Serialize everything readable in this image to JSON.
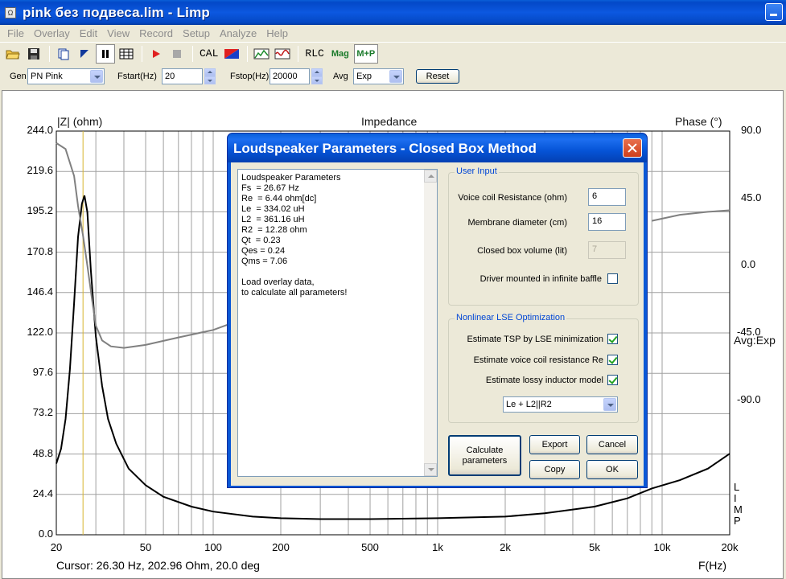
{
  "window": {
    "title": "pink без подвеса.lim - Limp",
    "icon": "app-icon"
  },
  "menu": [
    "File",
    "Overlay",
    "Edit",
    "View",
    "Record",
    "Setup",
    "Analyze",
    "Help"
  ],
  "toolbar": {
    "cal": "CAL",
    "rlc": "RLC",
    "mag": "Mag",
    "mp": "M+P"
  },
  "genbar": {
    "gen_label": "Gen",
    "gen_value": "PN Pink",
    "fstart_label": "Fstart(Hz)",
    "fstart_value": "20",
    "fstop_label": "Fstop(Hz)",
    "fstop_value": "20000",
    "avg_label": "Avg",
    "avg_value": "Exp",
    "reset": "Reset"
  },
  "chart_data": {
    "type": "line",
    "title": "Impedance",
    "ylabel": "|Z| (ohm)",
    "y2label": "Phase (°)",
    "xlabel": "F(Hz)",
    "xscale": "log",
    "xlim": [
      20,
      20000
    ],
    "ylim": [
      0,
      244
    ],
    "y2lim": [
      -180,
      90
    ],
    "yticks": [
      "244.0",
      "219.6",
      "195.2",
      "170.8",
      "146.4",
      "122.0",
      "97.6",
      "73.2",
      "48.8",
      "24.4",
      "0.0"
    ],
    "phase_ticks": [
      "90.0",
      "45.0",
      "0.0",
      "-45.0",
      "-90.0"
    ],
    "xticks": [
      {
        "v": 20,
        "label": "20"
      },
      {
        "v": 50,
        "label": "50"
      },
      {
        "v": 100,
        "label": "100"
      },
      {
        "v": 200,
        "label": "200"
      },
      {
        "v": 500,
        "label": "500"
      },
      {
        "v": 1000,
        "label": "1k"
      },
      {
        "v": 2000,
        "label": "2k"
      },
      {
        "v": 5000,
        "label": "5k"
      },
      {
        "v": 10000,
        "label": "10k"
      },
      {
        "v": 20000,
        "label": "20k"
      }
    ],
    "cursor_hz": 26.3,
    "series": [
      {
        "name": "|Z|",
        "color": "#000000",
        "points": [
          [
            20,
            43
          ],
          [
            21,
            52
          ],
          [
            22,
            70
          ],
          [
            23,
            100
          ],
          [
            24,
            140
          ],
          [
            25,
            180
          ],
          [
            26,
            200
          ],
          [
            26.7,
            205
          ],
          [
            27.5,
            195
          ],
          [
            28.5,
            160
          ],
          [
            30,
            120
          ],
          [
            32,
            90
          ],
          [
            34,
            70
          ],
          [
            37,
            55
          ],
          [
            42,
            40
          ],
          [
            50,
            30
          ],
          [
            60,
            23
          ],
          [
            80,
            17
          ],
          [
            100,
            14
          ],
          [
            150,
            11
          ],
          [
            200,
            10
          ],
          [
            300,
            9.5
          ],
          [
            500,
            9.5
          ],
          [
            1000,
            10
          ],
          [
            2000,
            11
          ],
          [
            3000,
            13
          ],
          [
            5000,
            17
          ],
          [
            7000,
            22
          ],
          [
            9000,
            28
          ],
          [
            12000,
            33
          ],
          [
            16000,
            40
          ],
          [
            20000,
            49
          ]
        ]
      },
      {
        "name": "Phase",
        "color": "#808080",
        "points": [
          [
            20,
            82
          ],
          [
            22,
            78
          ],
          [
            24,
            60
          ],
          [
            25,
            40
          ],
          [
            26.3,
            20
          ],
          [
            27.5,
            0
          ],
          [
            29,
            -25
          ],
          [
            30,
            -40
          ],
          [
            32,
            -50
          ],
          [
            35,
            -54
          ],
          [
            40,
            -55
          ],
          [
            50,
            -53
          ],
          [
            70,
            -48
          ],
          [
            100,
            -43
          ],
          [
            140,
            -35
          ],
          [
            160,
            -31
          ]
        ]
      },
      {
        "name": "Phase (right)",
        "color": "#808080",
        "points": [
          [
            9000,
            30
          ],
          [
            12000,
            34
          ],
          [
            16000,
            36
          ],
          [
            20000,
            37
          ]
        ]
      }
    ],
    "legend_right": [
      "L",
      "I",
      "M",
      "P"
    ]
  },
  "avg_label": "Avg:Exp",
  "status": {
    "cursor": "Cursor: 26.30 Hz, 202.96 Ohm, 20.0 deg"
  },
  "dialog": {
    "title": "Loudspeaker Parameters - Closed Box Method",
    "output_text": "Loudspeaker Parameters\nFs  = 26.67 Hz\nRe  = 6.44 ohm[dc]\nLe  = 334.02 uH\nL2  = 361.16 uH\nR2  = 12.28 ohm\nQt  = 0.23\nQes = 0.24\nQms = 7.06\n\nLoad overlay data,\nto calculate all parameters!",
    "user_input": {
      "label": "User Input",
      "vc_label": "Voice coil Resistance (ohm)",
      "vc_value": "6",
      "mem_label": "Membrane diameter (cm)",
      "mem_value": "16",
      "vol_label": "Closed box volume (lit)",
      "vol_value": "7",
      "baffle_label": "Driver mounted in infinite baffle",
      "baffle_checked": false
    },
    "lse": {
      "label": "Nonlinear LSE Optimization",
      "tsp_label": "Estimate TSP by LSE minimization",
      "re_label": "Estimate voice coil resistance Re",
      "lossy_label": "Estimate lossy inductor model",
      "model_value": "Le + L2||R2"
    },
    "buttons": {
      "calculate": "Calculate parameters",
      "export": "Export",
      "cancel": "Cancel",
      "copy": "Copy",
      "ok": "OK"
    }
  }
}
